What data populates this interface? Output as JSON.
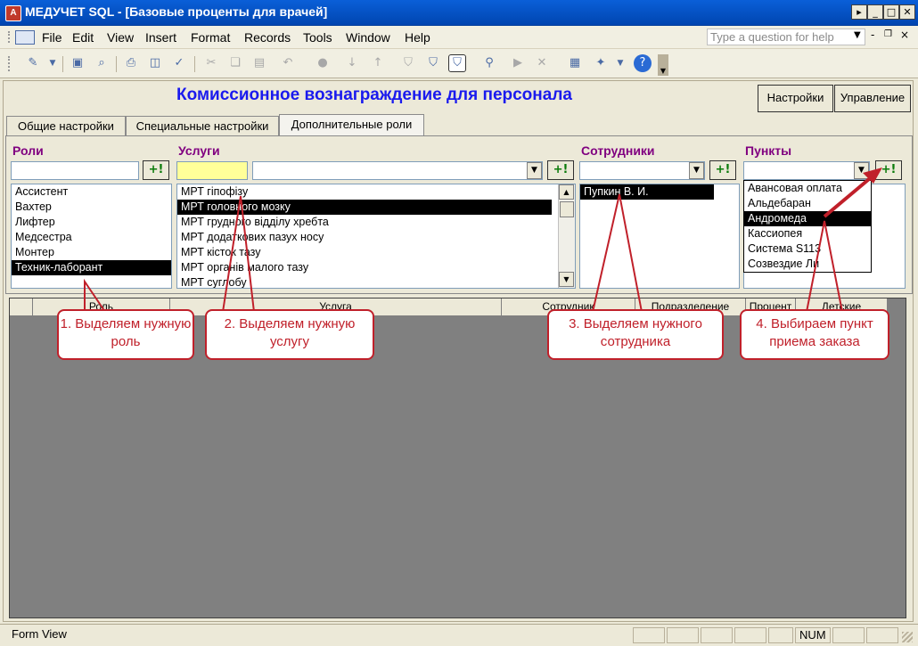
{
  "window": {
    "app_icon": "access-icon",
    "title": "МЕДУЧЕТ SQL - [Базовые проценты для врачей]"
  },
  "menubar": {
    "items": [
      "File",
      "Edit",
      "View",
      "Insert",
      "Format",
      "Records",
      "Tools",
      "Window",
      "Help"
    ],
    "help_placeholder": "Type a question for help"
  },
  "form": {
    "title": "Комиссионное вознаграждение для персонала",
    "buttons": {
      "settings": "Настройки",
      "manage": "Управление"
    },
    "tabs": [
      "Общие настройки",
      "Специальные настройки",
      "Дополнительные роли"
    ],
    "active_tab": "Дополнительные роли",
    "add_button_label": "+!",
    "sections": {
      "roles": {
        "label": "Роли",
        "items": [
          "Ассистент",
          "Вахтер",
          "Лифтер",
          "Медсестра",
          "Монтер",
          "Техник-лаборант"
        ],
        "selected": "Техник-лаборант"
      },
      "services": {
        "label": "Услуги",
        "items": [
          "МРТ гіпофізу",
          "МРТ головного мозку",
          "МРТ грудного відділу хребта",
          "МРТ додаткових пазух носу",
          "МРТ кісток тазу",
          "МРТ органів малого тазу",
          "МРТ суглобу"
        ],
        "selected": "МРТ головного мозку"
      },
      "employees": {
        "label": "Сотрудники",
        "items": [
          "Пупкин В. И."
        ],
        "selected": "Пупкин В. И."
      },
      "points": {
        "label": "Пункты",
        "items": [
          "Авансовая оплата",
          "Альдебаран",
          "Андромеда",
          "Кассиопея",
          "Система S113",
          "Созвездие Ли"
        ],
        "selected": "Андромеда"
      }
    },
    "grid_columns": [
      "Роль",
      "Услуга",
      "Сотрудник",
      "Подразделение",
      "Процент",
      "Детские"
    ]
  },
  "callouts": [
    "1. Выделяем нужную роль",
    "2. Выделяем нужную услугу",
    "3. Выделяем нужного сотрудника",
    "4. Выбираем пункт приема заказа"
  ],
  "statusbar": {
    "view": "Form View",
    "num": "NUM"
  },
  "colors": {
    "title_blue": "#1a1aee",
    "section_purple": "#800080",
    "callout_red": "#c0202a",
    "titlebar": "#0a5fd8"
  }
}
